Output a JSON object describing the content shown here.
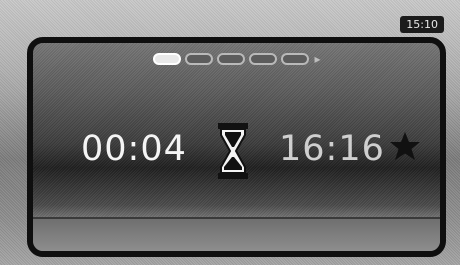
{
  "status": {
    "clock": "15:10"
  },
  "timer": {
    "elapsed": "00:04",
    "target_time": "16:16",
    "icon": "hourglass-icon"
  },
  "pager": {
    "pages": 5,
    "active_index": 0,
    "next_icon": "chevron-right-icon"
  },
  "favorite": {
    "icon": "star-icon"
  },
  "colors": {
    "frame": "#0f0f0f",
    "text_primary": "#f4f4f4",
    "text_secondary": "#cfcfcf"
  }
}
